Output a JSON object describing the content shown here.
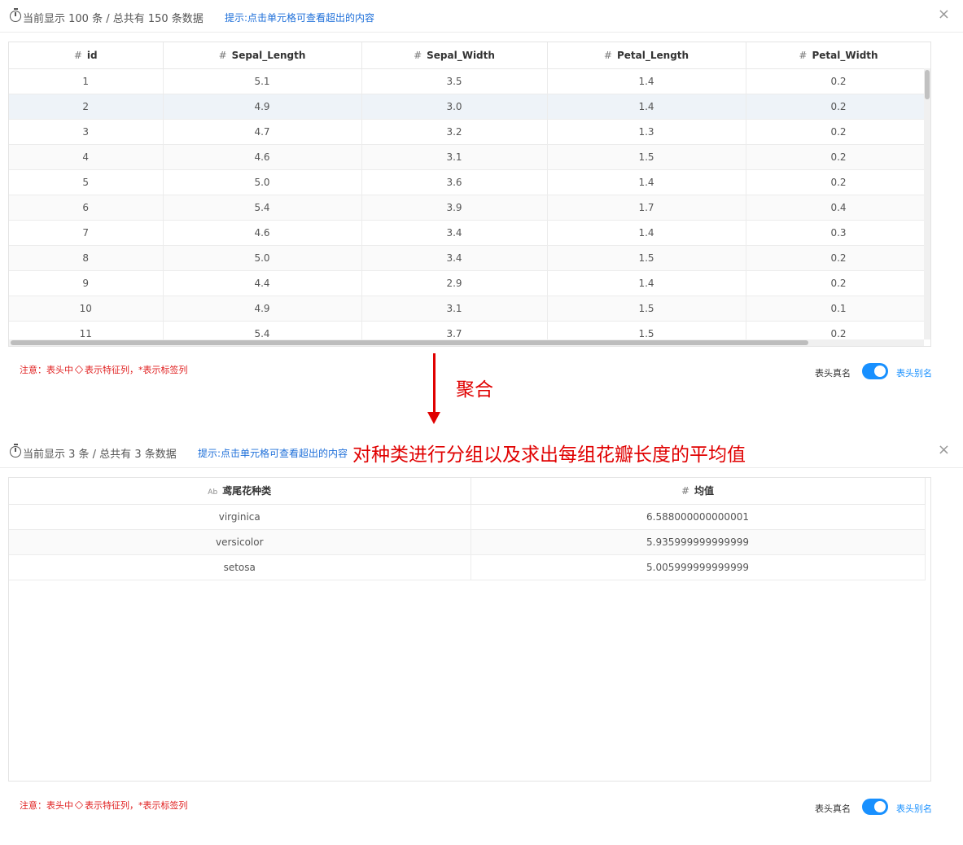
{
  "top": {
    "count_text": "当前显示 100 条 / 总共有 150 条数据",
    "tip": "提示:点击单元格可查看超出的内容",
    "close": "×",
    "columns": [
      {
        "type": "#",
        "label": "id"
      },
      {
        "type": "#",
        "label": "Sepal_Length"
      },
      {
        "type": "#",
        "label": "Sepal_Width"
      },
      {
        "type": "#",
        "label": "Petal_Length"
      },
      {
        "type": "#",
        "label": "Petal_Width"
      }
    ],
    "rows": [
      [
        "1",
        "5.1",
        "3.5",
        "1.4",
        "0.2"
      ],
      [
        "2",
        "4.9",
        "3.0",
        "1.4",
        "0.2"
      ],
      [
        "3",
        "4.7",
        "3.2",
        "1.3",
        "0.2"
      ],
      [
        "4",
        "4.6",
        "3.1",
        "1.5",
        "0.2"
      ],
      [
        "5",
        "5.0",
        "3.6",
        "1.4",
        "0.2"
      ],
      [
        "6",
        "5.4",
        "3.9",
        "1.7",
        "0.4"
      ],
      [
        "7",
        "4.6",
        "3.4",
        "1.4",
        "0.3"
      ],
      [
        "8",
        "5.0",
        "3.4",
        "1.5",
        "0.2"
      ],
      [
        "9",
        "4.4",
        "2.9",
        "1.4",
        "0.2"
      ],
      [
        "10",
        "4.9",
        "3.1",
        "1.5",
        "0.1"
      ],
      [
        "11",
        "5.4",
        "3.7",
        "1.5",
        "0.2"
      ]
    ],
    "note_prefix": "注意：表头中",
    "note_suffix": "表示特征列，*表示标签列",
    "toggle_real": "表头真名",
    "toggle_alias": "表头别名"
  },
  "annotation": {
    "aggregate": "聚合",
    "description": "对种类进行分组以及求出每组花瓣长度的平均值"
  },
  "bottom": {
    "count_text": "当前显示 3 条 / 总共有 3 条数据",
    "tip": "提示:点击单元格可查看超出的内容",
    "close": "×",
    "columns": [
      {
        "type": "Ab",
        "label": "鸢尾花种类"
      },
      {
        "type": "#",
        "label": "均值"
      }
    ],
    "rows": [
      [
        "virginica",
        "6.588000000000001"
      ],
      [
        "versicolor",
        "5.935999999999999"
      ],
      [
        "setosa",
        "5.005999999999999"
      ]
    ],
    "note_prefix": "注意：表头中",
    "note_suffix": "表示特征列，*表示标签列",
    "toggle_real": "表头真名",
    "toggle_alias": "表头别名"
  },
  "colors": {
    "accent": "#1890ff",
    "annotation_red": "#e00000",
    "note_red": "#e02020"
  }
}
